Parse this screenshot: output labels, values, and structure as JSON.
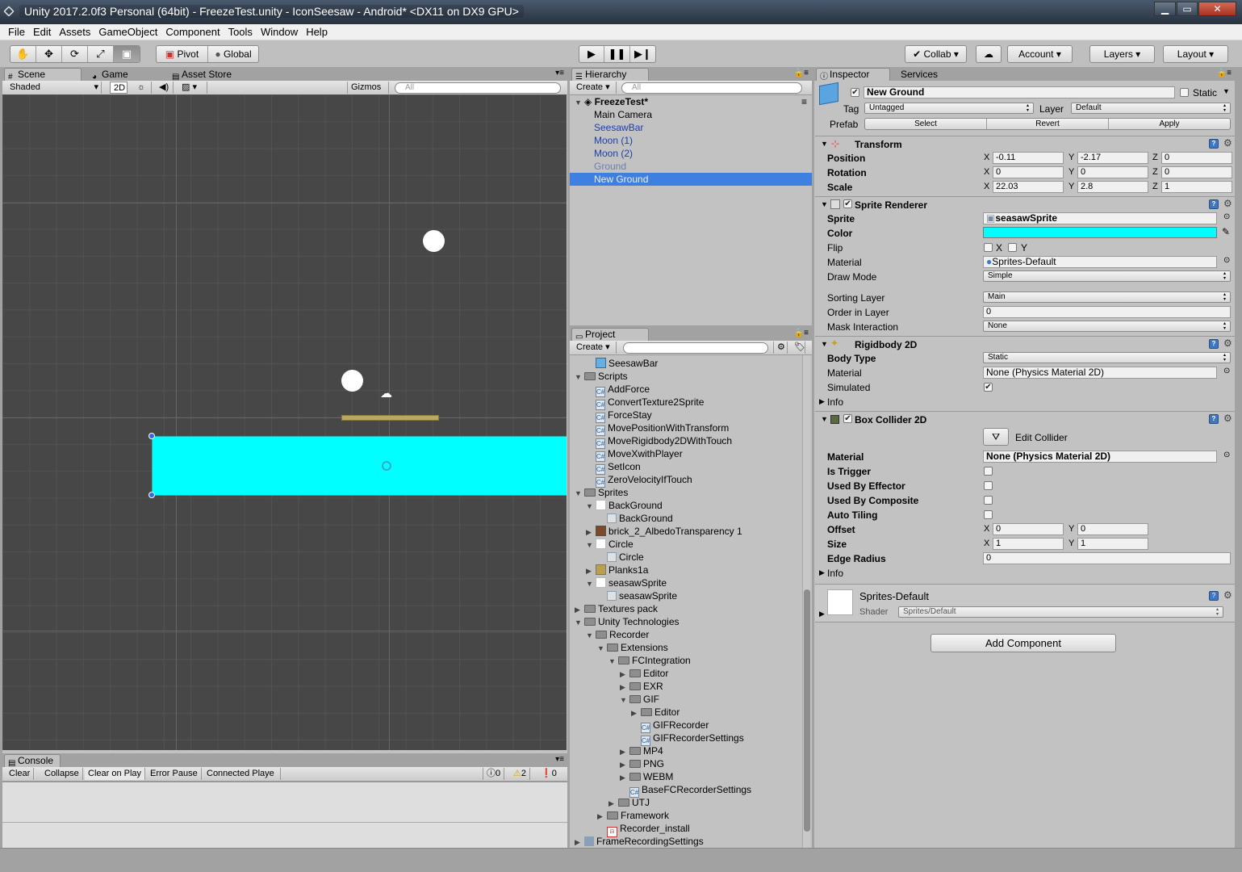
{
  "window": {
    "title": "Unity 2017.2.0f3 Personal (64bit) - FreezeTest.unity - IconSeesaw - Android* <DX11 on DX9 GPU>"
  },
  "menu": [
    "File",
    "Edit",
    "Assets",
    "GameObject",
    "Component",
    "Tools",
    "Window",
    "Help"
  ],
  "toolbar": {
    "pivot": "Pivot",
    "global": "Global",
    "collab": "Collab",
    "account": "Account",
    "layers": "Layers",
    "layout": "Layout"
  },
  "scene": {
    "tabs": [
      "Scene",
      "Game",
      "Asset Store"
    ],
    "shading": "Shaded",
    "mode2d": "2D",
    "gizmos": "Gizmos",
    "search_placeholder": "All"
  },
  "console": {
    "tab": "Console",
    "buttons": [
      "Clear",
      "Collapse",
      "Clear on Play",
      "Error Pause",
      "Connected Playe"
    ],
    "counts": {
      "info": "0",
      "warn": "2",
      "error": "0"
    }
  },
  "hierarchy": {
    "tab": "Hierarchy",
    "create": "Create",
    "search_placeholder": "All",
    "scene_name": "FreezeTest*",
    "items": [
      {
        "label": "Main Camera",
        "style": "normal"
      },
      {
        "label": "SeesawBar",
        "style": "prefab"
      },
      {
        "label": "Moon (1)",
        "style": "prefab"
      },
      {
        "label": "Moon (2)",
        "style": "prefab"
      },
      {
        "label": "Ground",
        "style": "prefab-disabled"
      },
      {
        "label": "New Ground",
        "style": "selected"
      }
    ]
  },
  "project": {
    "tab": "Project",
    "create": "Create",
    "items": [
      {
        "label": "SeesawBar",
        "depth": 1,
        "icon": "prefab",
        "fold": ""
      },
      {
        "label": "Scripts",
        "depth": 0,
        "icon": "folder",
        "fold": "open"
      },
      {
        "label": "AddForce",
        "depth": 1,
        "icon": "script",
        "fold": ""
      },
      {
        "label": "ConvertTexture2Sprite",
        "depth": 1,
        "icon": "script",
        "fold": ""
      },
      {
        "label": "ForceStay",
        "depth": 1,
        "icon": "script",
        "fold": ""
      },
      {
        "label": "MovePositionWithTransform",
        "depth": 1,
        "icon": "script",
        "fold": ""
      },
      {
        "label": "MoveRigidbody2DWithTouch",
        "depth": 1,
        "icon": "script",
        "fold": ""
      },
      {
        "label": "MoveXwithPlayer",
        "depth": 1,
        "icon": "script",
        "fold": ""
      },
      {
        "label": "SetIcon",
        "depth": 1,
        "icon": "script",
        "fold": ""
      },
      {
        "label": "ZeroVelocityIfTouch",
        "depth": 1,
        "icon": "script",
        "fold": ""
      },
      {
        "label": "Sprites",
        "depth": 0,
        "icon": "folder",
        "fold": "open"
      },
      {
        "label": "BackGround",
        "depth": 1,
        "icon": "sprite",
        "fold": "open"
      },
      {
        "label": "BackGround",
        "depth": 2,
        "icon": "subsprite",
        "fold": ""
      },
      {
        "label": "brick_2_AlbedoTransparency 1",
        "depth": 1,
        "icon": "brick",
        "fold": "closed"
      },
      {
        "label": "Circle",
        "depth": 1,
        "icon": "sprite",
        "fold": "open"
      },
      {
        "label": "Circle",
        "depth": 2,
        "icon": "subsprite",
        "fold": ""
      },
      {
        "label": "Planks1a",
        "depth": 1,
        "icon": "planks",
        "fold": "closed"
      },
      {
        "label": "seasawSprite",
        "depth": 1,
        "icon": "sprite",
        "fold": "open"
      },
      {
        "label": "seasawSprite",
        "depth": 2,
        "icon": "subsprite",
        "fold": ""
      },
      {
        "label": "Textures pack",
        "depth": 0,
        "icon": "folder",
        "fold": "closed"
      },
      {
        "label": "Unity Technologies",
        "depth": 0,
        "icon": "folder",
        "fold": "open"
      },
      {
        "label": "Recorder",
        "depth": 1,
        "icon": "folder",
        "fold": "open"
      },
      {
        "label": "Extensions",
        "depth": 2,
        "icon": "folder",
        "fold": "open"
      },
      {
        "label": "FCIntegration",
        "depth": 3,
        "icon": "folder",
        "fold": "open"
      },
      {
        "label": "Editor",
        "depth": 4,
        "icon": "folder",
        "fold": "closed"
      },
      {
        "label": "EXR",
        "depth": 4,
        "icon": "folder",
        "fold": "closed"
      },
      {
        "label": "GIF",
        "depth": 4,
        "icon": "folder",
        "fold": "open"
      },
      {
        "label": "Editor",
        "depth": 5,
        "icon": "folder",
        "fold": "closed"
      },
      {
        "label": "GIFRecorder",
        "depth": 5,
        "icon": "script",
        "fold": ""
      },
      {
        "label": "GIFRecorderSettings",
        "depth": 5,
        "icon": "script",
        "fold": ""
      },
      {
        "label": "MP4",
        "depth": 4,
        "icon": "folder",
        "fold": "closed"
      },
      {
        "label": "PNG",
        "depth": 4,
        "icon": "folder",
        "fold": "closed"
      },
      {
        "label": "WEBM",
        "depth": 4,
        "icon": "folder",
        "fold": "closed"
      },
      {
        "label": "BaseFCRecorderSettings",
        "depth": 4,
        "icon": "script",
        "fold": ""
      },
      {
        "label": "UTJ",
        "depth": 3,
        "icon": "folder",
        "fold": "closed"
      },
      {
        "label": "Framework",
        "depth": 2,
        "icon": "folder",
        "fold": "closed"
      },
      {
        "label": "Recorder_install",
        "depth": 2,
        "icon": "pdf",
        "fold": ""
      },
      {
        "label": "FrameRecordingSettings",
        "depth": 0,
        "icon": "asset",
        "fold": "closed"
      }
    ]
  },
  "inspector": {
    "tabs": [
      "Inspector",
      "Services"
    ],
    "object_name": "New Ground",
    "static_label": "Static",
    "tag_label": "Tag",
    "tag_value": "Untagged",
    "layer_label": "Layer",
    "layer_value": "Default",
    "prefab_label": "Prefab",
    "prefab_buttons": [
      "Select",
      "Revert",
      "Apply"
    ],
    "transform": {
      "title": "Transform",
      "rows": [
        {
          "label": "Position",
          "x": "-0.11",
          "y": "-2.17",
          "z": "0"
        },
        {
          "label": "Rotation",
          "x": "0",
          "y": "0",
          "z": "0"
        },
        {
          "label": "Scale",
          "x": "22.03",
          "y": "2.8",
          "z": "1"
        }
      ]
    },
    "sprite_renderer": {
      "title": "Sprite Renderer",
      "sprite_label": "Sprite",
      "sprite_value": "seasawSprite",
      "color_label": "Color",
      "color_value": "#00ffff",
      "flip_label": "Flip",
      "flip_x": "X",
      "flip_y": "Y",
      "material_label": "Material",
      "material_value": "Sprites-Default",
      "draw_mode_label": "Draw Mode",
      "draw_mode_value": "Simple",
      "sorting_layer_label": "Sorting Layer",
      "sorting_layer_value": "Main",
      "order_label": "Order in Layer",
      "order_value": "0",
      "mask_label": "Mask Interaction",
      "mask_value": "None"
    },
    "rigidbody": {
      "title": "Rigidbody 2D",
      "body_type_label": "Body Type",
      "body_type_value": "Static",
      "material_label": "Material",
      "material_value": "None (Physics Material 2D)",
      "simulated_label": "Simulated",
      "info_label": "Info"
    },
    "box_collider": {
      "title": "Box Collider 2D",
      "edit_collider": "Edit Collider",
      "material_label": "Material",
      "material_value": "None (Physics Material 2D)",
      "is_trigger": "Is Trigger",
      "used_by_effector": "Used By Effector",
      "used_by_composite": "Used By Composite",
      "auto_tiling": "Auto Tiling",
      "offset_label": "Offset",
      "offset_x": "0",
      "offset_y": "0",
      "size_label": "Size",
      "size_x": "1",
      "size_y": "1",
      "edge_radius_label": "Edge Radius",
      "edge_radius_value": "0",
      "info_label": "Info"
    },
    "material_block": {
      "name": "Sprites-Default",
      "shader_label": "Shader",
      "shader_value": "Sprites/Default"
    },
    "add_component": "Add Component"
  },
  "colors": {
    "selection": "#3d80df",
    "prefab_text": "#1a3fa8",
    "cyan": "#00ffff",
    "scene_bg": "#474747"
  }
}
